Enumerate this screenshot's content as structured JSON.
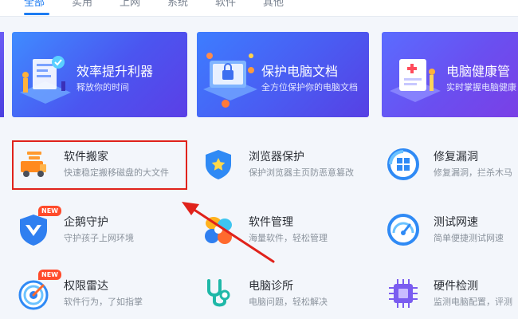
{
  "tabs": [
    "全部",
    "实用",
    "上网",
    "系统",
    "软件",
    "其他"
  ],
  "banners": [
    {
      "title": "效率提升利器",
      "subtitle": "释放你的时间"
    },
    {
      "title": "保护电脑文档",
      "subtitle": "全方位保护你的电脑文档"
    },
    {
      "title": "电脑健康管",
      "subtitle": "实时掌握电脑健康"
    }
  ],
  "items": [
    {
      "title": "软件搬家",
      "desc": "快速稳定搬移磁盘的大文件"
    },
    {
      "title": "浏览器保护",
      "desc": "保护浏览器主页防恶意篡改"
    },
    {
      "title": "修复漏洞",
      "desc": "修复漏洞，拦杀木马"
    },
    {
      "title": "企鹅守护",
      "desc": "守护孩子上网环境",
      "badge": "NEW"
    },
    {
      "title": "软件管理",
      "desc": "海量软件，轻松管理"
    },
    {
      "title": "测试网速",
      "desc": "简单便捷测试网速"
    },
    {
      "title": "权限雷达",
      "desc": "软件行为，了如指掌",
      "badge": "NEW"
    },
    {
      "title": "电脑诊所",
      "desc": "电脑问题，轻松解决"
    },
    {
      "title": "硬件检测",
      "desc": "监测电脑配置，评测"
    }
  ],
  "colors": {
    "accent": "#1d7cf2",
    "highlight": "#e0221b",
    "badge": "#ff4b2b"
  }
}
